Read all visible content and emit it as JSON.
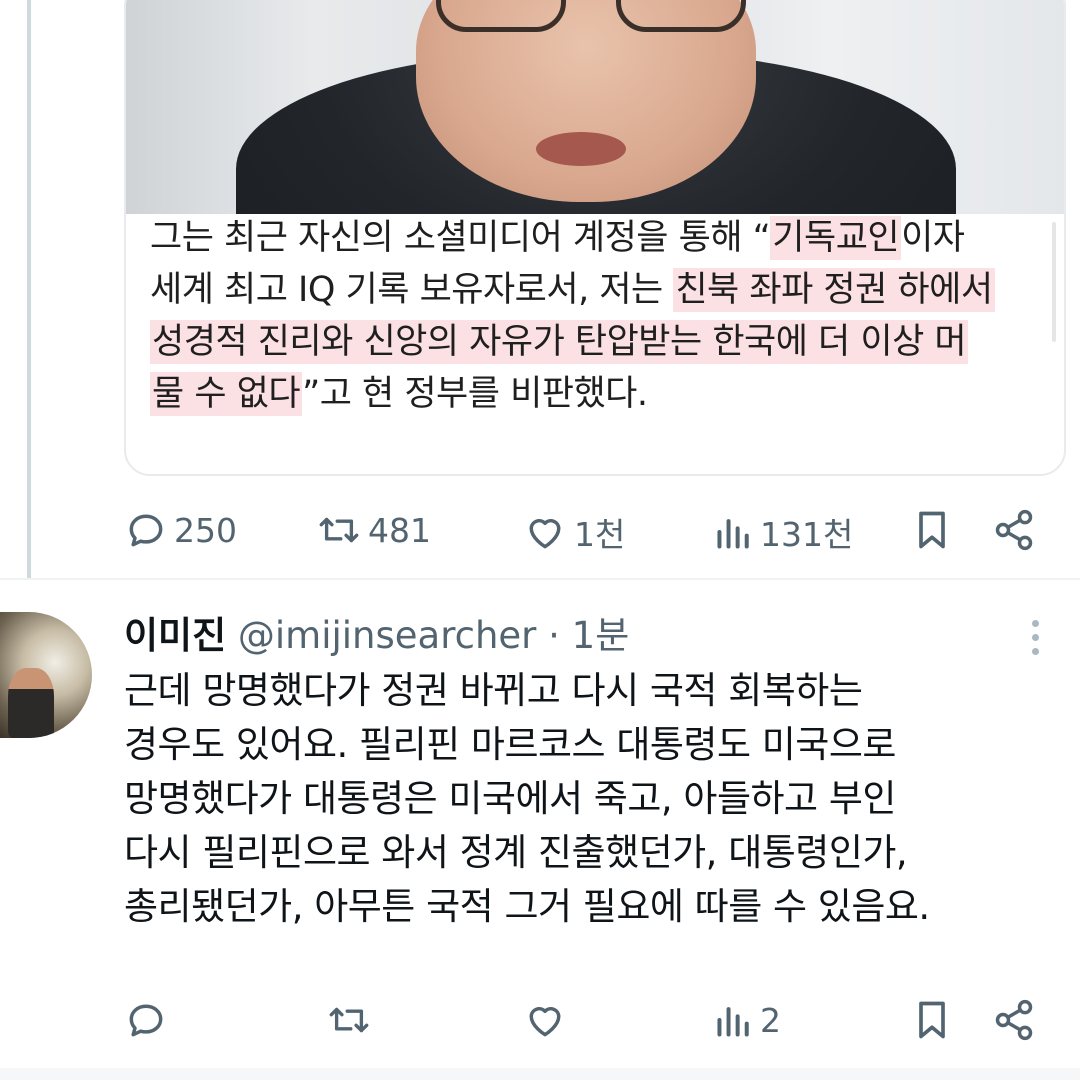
{
  "embed": {
    "caption_lines": [
      [
        {
          "t": "그는 최근 자신의 소셜미디어 계정을 통해 “",
          "h": false
        },
        {
          "t": "기독교인",
          "h": true
        },
        {
          "t": "이자",
          "h": false
        }
      ],
      [
        {
          "t": "세계 최고 IQ 기록 보유자로서, 저는 ",
          "h": false
        },
        {
          "t": "친북 좌파 정권 하에서",
          "h": true
        }
      ],
      [
        {
          "t": "성경적 진리와 신앙의 자유가 탄압받는 한국에 더 이상 머",
          "h": true
        }
      ],
      [
        {
          "t": "물 수 없다",
          "h": true
        },
        {
          "t": "”고 현 정부를 비판했다.",
          "h": false
        }
      ]
    ]
  },
  "post_actions": {
    "replies": "250",
    "reposts": "481",
    "likes": "1천",
    "views": "131천"
  },
  "reply": {
    "name": "이미진",
    "handle": "@imijinsearcher",
    "time": "· 1분",
    "text_lines": [
      "근데 망명했다가 정권 바뀌고 다시 국적 회복하는",
      "경우도 있어요. 필리핀 마르코스 대통령도 미국으로",
      "망명했다가 대통령은 미국에서 죽고, 아들하고 부인",
      "다시 필리핀으로 와서 정계 진출했던가, 대통령인가,",
      "총리됐던가, 아무튼 국적 그거 필요에 따를 수 있음요."
    ],
    "actions": {
      "replies": "",
      "reposts": "",
      "likes": "",
      "views": "2"
    }
  },
  "colors": {
    "icon_gray": "#536471",
    "highlight": "#fce1e4",
    "divider": "#eff3f4"
  },
  "icons": [
    "reply-icon",
    "repost-icon",
    "like-icon",
    "views-icon",
    "bookmark-icon",
    "share-icon",
    "more-icon"
  ]
}
